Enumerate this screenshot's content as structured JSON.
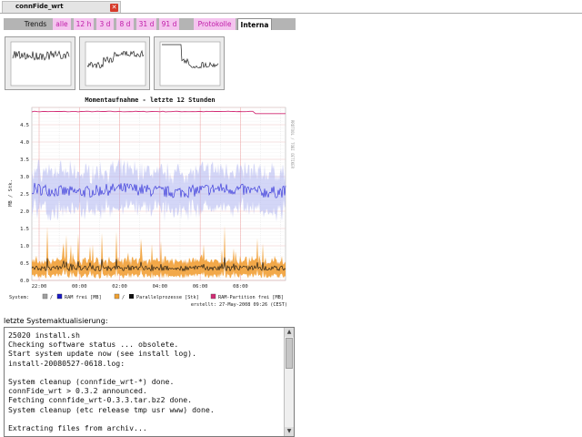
{
  "window": {
    "title": "connFide_wrt",
    "close_icon": "close-icon"
  },
  "nav": {
    "trends": "Trends",
    "tabs": [
      {
        "label": "alle"
      },
      {
        "label": "12 h"
      },
      {
        "label": "3 d"
      },
      {
        "label": "8 d"
      },
      {
        "label": "31 d"
      },
      {
        "label": "91 d"
      }
    ],
    "protokolle": "Protokolle",
    "interna": "Interna"
  },
  "colors": {
    "tab_pink": "#f4c4ee",
    "tab_text": "#c01aa8",
    "ram_blue": "#2a2ad8",
    "cpu_orange": "#f09a2a",
    "ram_partition": "#d22a74"
  },
  "chart_data": {
    "type": "line",
    "title": "Momentaufnahme - letzte 12 Stunden",
    "ylabel": "MB / Stk.",
    "ylim": [
      0,
      5
    ],
    "yticks": [
      "0.0",
      "0.5",
      "1.0",
      "1.5",
      "2.0",
      "2.5",
      "3.0",
      "3.5",
      "4.0",
      "4.5"
    ],
    "xticks": [
      "22:00",
      "00:00",
      "02:00",
      "04:00",
      "06:00",
      "08:00"
    ],
    "right_label": "RRDTOOL / TOBI OETIKER",
    "legend": {
      "prefix": "System:",
      "items": [
        "/",
        "RAM frei [MB]",
        "/",
        "Parallelprozesse [Stk]",
        "RAM-Partition frei [MB]"
      ]
    },
    "footer": "erstellt: 27-May-2008 09:26 (CEST)",
    "series": [
      {
        "name": "RAM frei [MB]",
        "level": 2.6
      },
      {
        "name": "Parallelprozesse [Stk]",
        "level": 0.35
      },
      {
        "name": "RAM-Partition frei [MB]",
        "level": 4.88
      }
    ]
  },
  "log": {
    "label": "letzte Systemaktualisierung:",
    "lines": [
      "25020 install.sh",
      "Checking software status ... obsolete.",
      "Start system update now (see install log).",
      "install-20080527-0618.log:",
      "",
      "System cleanup (connfide_wrt-*) done.",
      "connFide_wrt > 0.3.2 announced.",
      "Fetching connfide_wrt-0.3.3.tar.bz2 done.",
      "System cleanup (etc release tmp usr www) done.",
      "",
      "Extracting files from archiv..."
    ]
  }
}
